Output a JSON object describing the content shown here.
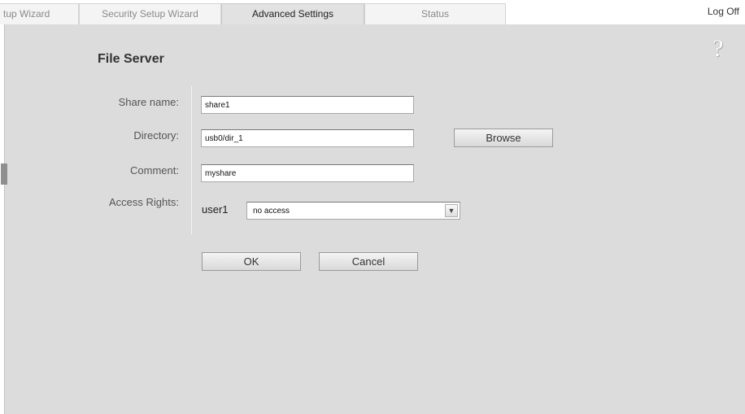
{
  "tabs": [
    {
      "label": "tup Wizard",
      "active": false
    },
    {
      "label": "Security Setup Wizard",
      "active": false
    },
    {
      "label": "Advanced Settings",
      "active": true
    },
    {
      "label": "Status",
      "active": false
    }
  ],
  "header": {
    "logoff": "Log Off"
  },
  "help": {
    "icon": "help-question-icon",
    "glyph": "?"
  },
  "page": {
    "title": "File Server"
  },
  "form": {
    "share_name_label": "Share name:",
    "share_name_value": "share1",
    "directory_label": "Directory:",
    "directory_value": "usb0/dir_1",
    "browse_label": "Browse",
    "comment_label": "Comment:",
    "comment_value": "myshare",
    "access_rights_label": "Access Rights:",
    "access_user": "user1",
    "access_selected": "no access"
  },
  "actions": {
    "ok": "OK",
    "cancel": "Cancel"
  },
  "icons": {
    "dropdown": "chevron-down-icon"
  },
  "colors": {
    "panel": "#dcdcdc",
    "active_tab": "#e2e2e2",
    "inactive_tab": "#f4f4f4"
  }
}
